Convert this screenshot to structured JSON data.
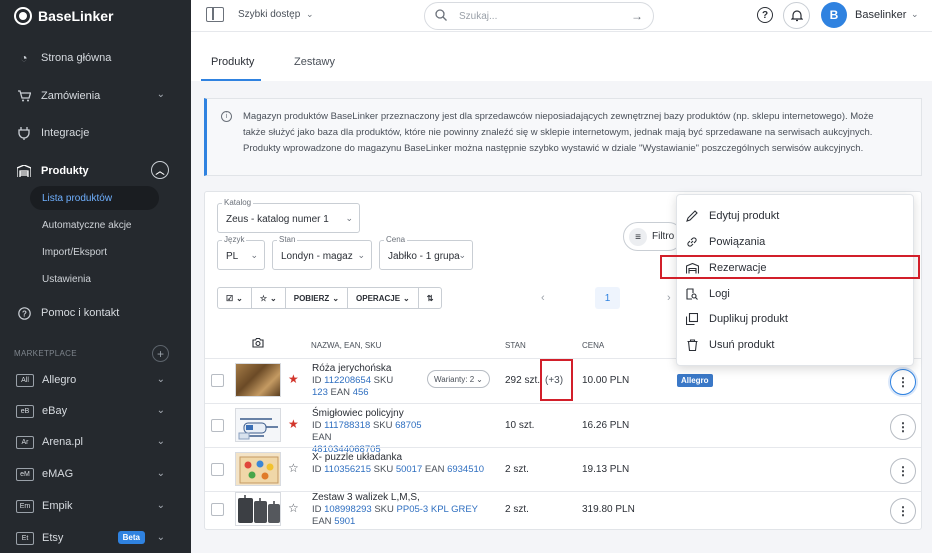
{
  "app": {
    "brand": "BaseLinker"
  },
  "sidebar": {
    "items": [
      {
        "label": "Strona główna",
        "icon": "gauge-icon"
      },
      {
        "label": "Zamówienia",
        "icon": "cart-icon"
      },
      {
        "label": "Integracje",
        "icon": "plug-icon"
      },
      {
        "label": "Produkty",
        "icon": "warehouse-icon"
      }
    ],
    "sub_items": [
      "Lista produktów",
      "Automatyczne akcje",
      "Import/Eksport",
      "Ustawienia"
    ],
    "help": "Pomoc i kontakt",
    "section_label": "MARKETPLACE",
    "marketplaces": [
      {
        "badge": "All",
        "label": "Allegro"
      },
      {
        "badge": "eB",
        "label": "eBay"
      },
      {
        "badge": "Ar",
        "label": "Arena.pl"
      },
      {
        "badge": "eM",
        "label": "eMAG"
      },
      {
        "badge": "Em",
        "label": "Empik"
      },
      {
        "badge": "Et",
        "label": "Etsy",
        "tag": "Beta"
      }
    ]
  },
  "topbar": {
    "quick_access": "Szybki dostęp",
    "search_placeholder": "Szukaj...",
    "help": "?",
    "avatar_initial": "B",
    "username": "Baselinker"
  },
  "tabs": [
    "Produkty",
    "Zestawy"
  ],
  "info": "Magazyn produktów BaseLinker przeznaczony jest dla sprzedawców nieposiadających zewnętrznej bazy produktów (np. sklepu internetowego). Może także służyć jako baza dla produktów, które nie powinny znaleźć się w sklepie internetowym, jednak mają być sprzedawane na serwisach aukcyjnych. Produkty wprowadzone do magazynu BaseLinker można następnie szybko wystawić w dziale \"Wystawianie\" poszczególnych serwisów aukcyjnych.",
  "filters": {
    "katalog": {
      "label": "Katalog",
      "value": "Zeus - katalog numer 1"
    },
    "jezyk": {
      "label": "Język",
      "value": "PL"
    },
    "stan": {
      "label": "Stan",
      "value": "Londyn - magaz"
    },
    "cena": {
      "label": "Cena",
      "value": "Jabłko - 1 grupa"
    },
    "filter_button": "Filtro"
  },
  "toolbar": {
    "pobierz": "POBIERZ",
    "operacje": "OPERACJE"
  },
  "pagination": {
    "page": "1"
  },
  "columns": {
    "name": "NAZWA, EAN, SKU",
    "stock": "STAN",
    "price": "CENA"
  },
  "products": [
    {
      "name": "Róża jerychońska",
      "id_label": "ID",
      "id": "112208654",
      "sku_label": "SKU",
      "sku": "123",
      "ean_label": "EAN",
      "ean": "456",
      "variants": "Warianty: 2",
      "stock": "292 szt.",
      "stock_extra": "(+3)",
      "price": "10.00 PLN",
      "tag": "Allegro",
      "favorite": true
    },
    {
      "name": "Śmigłowiec policyjny",
      "id_label": "ID",
      "id": "111788318",
      "sku_label": "SKU",
      "sku": "68705",
      "ean_label": "EAN",
      "ean": "4810344068705",
      "stock": "10 szt.",
      "price": "16.26 PLN",
      "favorite": true
    },
    {
      "name": "X- puzzle układanka",
      "id_label": "ID",
      "id": "110356215",
      "sku_label": "SKU",
      "sku": "50017",
      "ean_label": "EAN",
      "ean": "6934510",
      "stock": "2 szt.",
      "price": "19.13 PLN",
      "favorite": false
    },
    {
      "name": "Zestaw 3 walizek L,M,S,",
      "id_label": "ID",
      "id": "108998293",
      "sku_label": "SKU",
      "sku": "PP05-3 KPL GREY",
      "ean_label": "EAN",
      "ean": "5901",
      "stock": "2 szt.",
      "price": "319.80 PLN",
      "favorite": false
    }
  ],
  "menu": [
    "Edytuj produkt",
    "Powiązania",
    "Rezerwacje",
    "Logi",
    "Duplikuj produkt",
    "Usuń produkt"
  ],
  "colors": {
    "accent": "#2f82e0",
    "sidebar": "#25292e",
    "highlight": "#d21f2a",
    "favorite": "#d2352b"
  }
}
